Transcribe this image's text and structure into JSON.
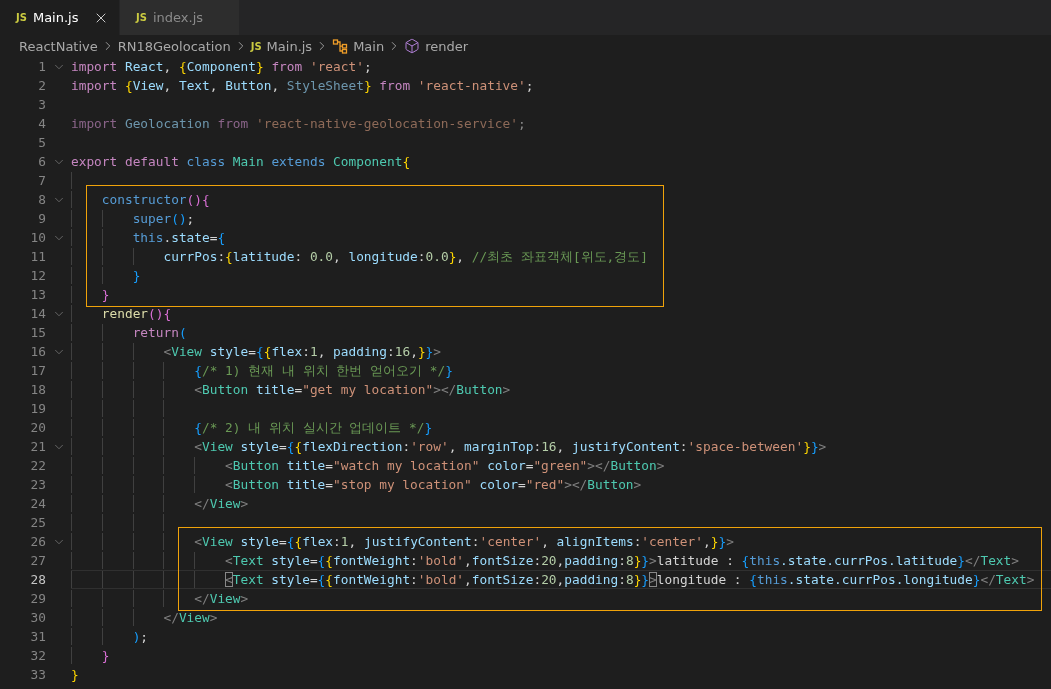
{
  "tabs": [
    {
      "icon_text": "JS",
      "label": "Main.js",
      "selected": true
    },
    {
      "icon_text": "JS",
      "label": "index.js",
      "selected": false
    }
  ],
  "breadcrumbs": [
    {
      "kind": "folder",
      "label": "ReactNative"
    },
    {
      "kind": "folder",
      "label": "RN18Geolocation"
    },
    {
      "kind": "file",
      "icon_text": "JS",
      "label": "Main.js"
    },
    {
      "kind": "class",
      "label": "Main"
    },
    {
      "kind": "method",
      "label": "render"
    }
  ],
  "lines": [
    {
      "number": "1",
      "fold": true,
      "boxed": false,
      "current": false,
      "tokens": [
        {
          "text": "import",
          "kind": "kw"
        },
        {
          "text": " React",
          "kind": "var"
        },
        {
          "text": ", ",
          "kind": "txt"
        },
        {
          "text": "{",
          "kind": "b1"
        },
        {
          "text": "Component",
          "kind": "var"
        },
        {
          "text": "}",
          "kind": "b1"
        },
        {
          "text": " from",
          "kind": "kw"
        },
        {
          "text": " 'react'",
          "kind": "str"
        },
        {
          "text": ";",
          "kind": "txt"
        }
      ]
    },
    {
      "number": "2",
      "fold": false,
      "boxed": false,
      "current": false,
      "tokens": [
        {
          "text": "import",
          "kind": "kw"
        },
        {
          "text": " {",
          "kind": "b1"
        },
        {
          "text": "View",
          "kind": "var"
        },
        {
          "text": ", ",
          "kind": "txt"
        },
        {
          "text": "Text",
          "kind": "var"
        },
        {
          "text": ", ",
          "kind": "txt"
        },
        {
          "text": "Button",
          "kind": "var"
        },
        {
          "text": ", ",
          "kind": "txt"
        },
        {
          "text": "StyleSheet",
          "kind": "dvar"
        },
        {
          "text": "}",
          "kind": "b1"
        },
        {
          "text": " from",
          "kind": "kw"
        },
        {
          "text": " 'react-native'",
          "kind": "str"
        },
        {
          "text": ";",
          "kind": "txt"
        }
      ]
    },
    {
      "number": "3",
      "fold": false,
      "boxed": false,
      "current": false
    },
    {
      "number": "4",
      "fold": false,
      "boxed": false,
      "current": false,
      "tokens": [
        {
          "text": "import",
          "kind": "dkw"
        },
        {
          "text": " Geolocation",
          "kind": "dvar"
        },
        {
          "text": " from",
          "kind": "dkw"
        },
        {
          "text": " 'react-native-geolocation-service'",
          "kind": "dstr"
        },
        {
          "text": ";",
          "kind": "dtxt"
        }
      ]
    },
    {
      "number": "5",
      "fold": false,
      "boxed": false,
      "current": false
    },
    {
      "number": "6",
      "fold": true,
      "boxed": false,
      "current": false,
      "tokens": [
        {
          "text": "export",
          "kind": "kw"
        },
        {
          "text": " default",
          "kind": "kw"
        },
        {
          "text": " class",
          "kind": "blue"
        },
        {
          "text": " Main",
          "kind": "type"
        },
        {
          "text": " extends",
          "kind": "blue"
        },
        {
          "text": " Component",
          "kind": "type"
        },
        {
          "text": "{",
          "kind": "b1"
        }
      ]
    },
    {
      "number": "7",
      "fold": false,
      "boxed": false,
      "current": false
    },
    {
      "number": "8",
      "fold": true,
      "boxed": true,
      "current": false,
      "tokens": [
        {
          "text": "    constructor",
          "kind": "blue"
        },
        {
          "text": "()",
          "kind": "b2"
        },
        {
          "text": "{",
          "kind": "b2"
        }
      ]
    },
    {
      "number": "9",
      "fold": false,
      "boxed": true,
      "current": false,
      "tokens": [
        {
          "text": "        super",
          "kind": "blue"
        },
        {
          "text": "()",
          "kind": "b3"
        },
        {
          "text": ";",
          "kind": "txt"
        }
      ]
    },
    {
      "number": "10",
      "fold": true,
      "boxed": true,
      "current": false,
      "tokens": [
        {
          "text": "        this",
          "kind": "blue"
        },
        {
          "text": ".",
          "kind": "txt"
        },
        {
          "text": "state",
          "kind": "var"
        },
        {
          "text": "=",
          "kind": "txt"
        },
        {
          "text": "{",
          "kind": "b3"
        }
      ]
    },
    {
      "number": "11",
      "fold": false,
      "boxed": true,
      "current": false,
      "tokens": [
        {
          "text": "            currPos",
          "kind": "var"
        },
        {
          "text": ":",
          "kind": "txt"
        },
        {
          "text": "{",
          "kind": "b1"
        },
        {
          "text": "latitude",
          "kind": "var"
        },
        {
          "text": ": ",
          "kind": "txt"
        },
        {
          "text": "0.0",
          "kind": "num"
        },
        {
          "text": ", ",
          "kind": "txt"
        },
        {
          "text": "longitude",
          "kind": "var"
        },
        {
          "text": ":",
          "kind": "txt"
        },
        {
          "text": "0.0",
          "kind": "num"
        },
        {
          "text": "}",
          "kind": "b1"
        },
        {
          "text": ", ",
          "kind": "txt"
        },
        {
          "text": "//최초 좌표객체[위도,경도]",
          "kind": "cmt"
        }
      ]
    },
    {
      "number": "12",
      "fold": false,
      "boxed": true,
      "current": false,
      "tokens": [
        {
          "text": "        }",
          "kind": "b3"
        }
      ]
    },
    {
      "number": "13",
      "fold": false,
      "boxed": true,
      "current": false,
      "tokens": [
        {
          "text": "    }",
          "kind": "b2"
        }
      ]
    },
    {
      "number": "14",
      "fold": true,
      "boxed": false,
      "current": false,
      "tokens": [
        {
          "text": "    render",
          "kind": "fn"
        },
        {
          "text": "()",
          "kind": "b2"
        },
        {
          "text": "{",
          "kind": "b2"
        }
      ]
    },
    {
      "number": "15",
      "fold": false,
      "boxed": false,
      "current": false,
      "tokens": [
        {
          "text": "        return",
          "kind": "kw"
        },
        {
          "text": "(",
          "kind": "b3"
        }
      ]
    },
    {
      "number": "16",
      "fold": true,
      "boxed": false,
      "current": false,
      "tokens": [
        {
          "text": "            <",
          "kind": "tag"
        },
        {
          "text": "View",
          "kind": "type"
        },
        {
          "text": " style",
          "kind": "var"
        },
        {
          "text": "=",
          "kind": "txt"
        },
        {
          "text": "{",
          "kind": "b3"
        },
        {
          "text": "{",
          "kind": "b1"
        },
        {
          "text": "flex",
          "kind": "var"
        },
        {
          "text": ":",
          "kind": "txt"
        },
        {
          "text": "1",
          "kind": "num"
        },
        {
          "text": ", ",
          "kind": "txt"
        },
        {
          "text": "padding",
          "kind": "var"
        },
        {
          "text": ":",
          "kind": "txt"
        },
        {
          "text": "16",
          "kind": "num"
        },
        {
          "text": ",",
          "kind": "txt"
        },
        {
          "text": "}",
          "kind": "b1"
        },
        {
          "text": "}",
          "kind": "b3"
        },
        {
          "text": ">",
          "kind": "tag"
        }
      ]
    },
    {
      "number": "17",
      "fold": false,
      "boxed": false,
      "current": false,
      "tokens": [
        {
          "text": "                {",
          "kind": "b3"
        },
        {
          "text": "/* 1) 현재 내 위치 한번 얻어오기 */",
          "kind": "cmt"
        },
        {
          "text": "}",
          "kind": "b3"
        }
      ]
    },
    {
      "number": "18",
      "fold": false,
      "boxed": false,
      "current": false,
      "tokens": [
        {
          "text": "                <",
          "kind": "tag"
        },
        {
          "text": "Button",
          "kind": "type"
        },
        {
          "text": " title",
          "kind": "var"
        },
        {
          "text": "=",
          "kind": "txt"
        },
        {
          "text": "\"get my location\"",
          "kind": "str"
        },
        {
          "text": "></",
          "kind": "tag"
        },
        {
          "text": "Button",
          "kind": "type"
        },
        {
          "text": ">",
          "kind": "tag"
        }
      ]
    },
    {
      "number": "19",
      "fold": false,
      "boxed": false,
      "current": false
    },
    {
      "number": "20",
      "fold": false,
      "boxed": false,
      "current": false,
      "tokens": [
        {
          "text": "                {",
          "kind": "b3"
        },
        {
          "text": "/* 2) 내 위치 실시간 업데이트 */",
          "kind": "cmt"
        },
        {
          "text": "}",
          "kind": "b3"
        }
      ]
    },
    {
      "number": "21",
      "fold": true,
      "boxed": false,
      "current": false,
      "tokens": [
        {
          "text": "                <",
          "kind": "tag"
        },
        {
          "text": "View",
          "kind": "type"
        },
        {
          "text": " style",
          "kind": "var"
        },
        {
          "text": "=",
          "kind": "txt"
        },
        {
          "text": "{",
          "kind": "b3"
        },
        {
          "text": "{",
          "kind": "b1"
        },
        {
          "text": "flexDirection",
          "kind": "var"
        },
        {
          "text": ":",
          "kind": "txt"
        },
        {
          "text": "'row'",
          "kind": "str"
        },
        {
          "text": ", ",
          "kind": "txt"
        },
        {
          "text": "marginTop",
          "kind": "var"
        },
        {
          "text": ":",
          "kind": "txt"
        },
        {
          "text": "16",
          "kind": "num"
        },
        {
          "text": ", ",
          "kind": "txt"
        },
        {
          "text": "justifyContent",
          "kind": "var"
        },
        {
          "text": ":",
          "kind": "txt"
        },
        {
          "text": "'space-between'",
          "kind": "str"
        },
        {
          "text": "}",
          "kind": "b1"
        },
        {
          "text": "}",
          "kind": "b3"
        },
        {
          "text": ">",
          "kind": "tag"
        }
      ]
    },
    {
      "number": "22",
      "fold": false,
      "boxed": false,
      "current": false,
      "tokens": [
        {
          "text": "                    <",
          "kind": "tag"
        },
        {
          "text": "Button",
          "kind": "type"
        },
        {
          "text": " title",
          "kind": "var"
        },
        {
          "text": "=",
          "kind": "txt"
        },
        {
          "text": "\"watch my location\"",
          "kind": "str"
        },
        {
          "text": " color",
          "kind": "var"
        },
        {
          "text": "=",
          "kind": "txt"
        },
        {
          "text": "\"green\"",
          "kind": "str"
        },
        {
          "text": "></",
          "kind": "tag"
        },
        {
          "text": "Button",
          "kind": "type"
        },
        {
          "text": ">",
          "kind": "tag"
        }
      ]
    },
    {
      "number": "23",
      "fold": false,
      "boxed": false,
      "current": false,
      "tokens": [
        {
          "text": "                    <",
          "kind": "tag"
        },
        {
          "text": "Button",
          "kind": "type"
        },
        {
          "text": " title",
          "kind": "var"
        },
        {
          "text": "=",
          "kind": "txt"
        },
        {
          "text": "\"stop my location\"",
          "kind": "str"
        },
        {
          "text": " color",
          "kind": "var"
        },
        {
          "text": "=",
          "kind": "txt"
        },
        {
          "text": "\"red\"",
          "kind": "str"
        },
        {
          "text": "></",
          "kind": "tag"
        },
        {
          "text": "Button",
          "kind": "type"
        },
        {
          "text": ">",
          "kind": "tag"
        }
      ]
    },
    {
      "number": "24",
      "fold": false,
      "boxed": false,
      "current": false,
      "tokens": [
        {
          "text": "                </",
          "kind": "tag"
        },
        {
          "text": "View",
          "kind": "type"
        },
        {
          "text": ">",
          "kind": "tag"
        }
      ]
    },
    {
      "number": "25",
      "fold": false,
      "boxed": false,
      "current": false
    },
    {
      "number": "26",
      "fold": true,
      "boxed": true,
      "current": false,
      "tokens": [
        {
          "text": "                <",
          "kind": "tag"
        },
        {
          "text": "View",
          "kind": "type"
        },
        {
          "text": " style",
          "kind": "var"
        },
        {
          "text": "=",
          "kind": "txt"
        },
        {
          "text": "{",
          "kind": "b3"
        },
        {
          "text": "{",
          "kind": "b1"
        },
        {
          "text": "flex",
          "kind": "var"
        },
        {
          "text": ":",
          "kind": "txt"
        },
        {
          "text": "1",
          "kind": "num"
        },
        {
          "text": ", ",
          "kind": "txt"
        },
        {
          "text": "justifyContent",
          "kind": "var"
        },
        {
          "text": ":",
          "kind": "txt"
        },
        {
          "text": "'center'",
          "kind": "str"
        },
        {
          "text": ", ",
          "kind": "txt"
        },
        {
          "text": "alignItems",
          "kind": "var"
        },
        {
          "text": ":",
          "kind": "txt"
        },
        {
          "text": "'center'",
          "kind": "str"
        },
        {
          "text": ",",
          "kind": "txt"
        },
        {
          "text": "}",
          "kind": "b1"
        },
        {
          "text": "}",
          "kind": "b3"
        },
        {
          "text": ">",
          "kind": "tag"
        }
      ]
    },
    {
      "number": "27",
      "fold": false,
      "boxed": true,
      "current": false,
      "tokens": [
        {
          "text": "                    <",
          "kind": "tag"
        },
        {
          "text": "Text",
          "kind": "type"
        },
        {
          "text": " style",
          "kind": "var"
        },
        {
          "text": "=",
          "kind": "txt"
        },
        {
          "text": "{",
          "kind": "b3"
        },
        {
          "text": "{",
          "kind": "b1"
        },
        {
          "text": "fontWeight",
          "kind": "var"
        },
        {
          "text": ":",
          "kind": "txt"
        },
        {
          "text": "'bold'",
          "kind": "str"
        },
        {
          "text": ",",
          "kind": "txt"
        },
        {
          "text": "fontSize",
          "kind": "var"
        },
        {
          "text": ":",
          "kind": "txt"
        },
        {
          "text": "20",
          "kind": "num"
        },
        {
          "text": ",",
          "kind": "txt"
        },
        {
          "text": "padding",
          "kind": "var"
        },
        {
          "text": ":",
          "kind": "txt"
        },
        {
          "text": "8",
          "kind": "num"
        },
        {
          "text": "}",
          "kind": "b1"
        },
        {
          "text": "}",
          "kind": "b3"
        },
        {
          "text": ">",
          "kind": "tag"
        },
        {
          "text": "latitude : ",
          "kind": "txt"
        },
        {
          "text": "{",
          "kind": "b3"
        },
        {
          "text": "this",
          "kind": "blue"
        },
        {
          "text": ".state.currPos.latitude",
          "kind": "var"
        },
        {
          "text": "}",
          "kind": "b3"
        },
        {
          "text": "</",
          "kind": "tag"
        },
        {
          "text": "Text",
          "kind": "type"
        },
        {
          "text": ">",
          "kind": "tag"
        }
      ]
    },
    {
      "number": "28",
      "fold": false,
      "boxed": true,
      "current": true,
      "tokens": [
        {
          "text": "                    <",
          "kind": "match"
        },
        {
          "text": "Text",
          "kind": "type"
        },
        {
          "text": " style",
          "kind": "var"
        },
        {
          "text": "=",
          "kind": "txt"
        },
        {
          "text": "{",
          "kind": "b3"
        },
        {
          "text": "{",
          "kind": "b1"
        },
        {
          "text": "fontWeight",
          "kind": "var"
        },
        {
          "text": ":",
          "kind": "txt"
        },
        {
          "text": "'bold'",
          "kind": "str"
        },
        {
          "text": ",",
          "kind": "txt"
        },
        {
          "text": "fontSize",
          "kind": "var"
        },
        {
          "text": ":",
          "kind": "txt"
        },
        {
          "text": "20",
          "kind": "num"
        },
        {
          "text": ",",
          "kind": "txt"
        },
        {
          "text": "padding",
          "kind": "var"
        },
        {
          "text": ":",
          "kind": "txt"
        },
        {
          "text": "8",
          "kind": "num"
        },
        {
          "text": "}",
          "kind": "b1"
        },
        {
          "text": "}",
          "kind": "b3"
        },
        {
          "text": ">",
          "kind": "match"
        },
        {
          "text": "longitude : ",
          "kind": "txt"
        },
        {
          "text": "{",
          "kind": "b3"
        },
        {
          "text": "this",
          "kind": "blue"
        },
        {
          "text": ".state.currPos.longitude",
          "kind": "var"
        },
        {
          "text": "}",
          "kind": "b3"
        },
        {
          "text": "</",
          "kind": "tag"
        },
        {
          "text": "Text",
          "kind": "type"
        },
        {
          "text": ">",
          "kind": "tag"
        }
      ]
    },
    {
      "number": "29",
      "fold": false,
      "boxed": true,
      "current": false,
      "tokens": [
        {
          "text": "                </",
          "kind": "tag"
        },
        {
          "text": "View",
          "kind": "type"
        },
        {
          "text": ">",
          "kind": "tag"
        }
      ]
    },
    {
      "number": "30",
      "fold": false,
      "boxed": false,
      "current": false,
      "tokens": [
        {
          "text": "            </",
          "kind": "tag"
        },
        {
          "text": "View",
          "kind": "type"
        },
        {
          "text": ">",
          "kind": "tag"
        }
      ]
    },
    {
      "number": "31",
      "fold": false,
      "boxed": false,
      "current": false,
      "tokens": [
        {
          "text": "        )",
          "kind": "b3"
        },
        {
          "text": ";",
          "kind": "txt"
        }
      ]
    },
    {
      "number": "32",
      "fold": false,
      "boxed": false,
      "current": false,
      "tokens": [
        {
          "text": "    }",
          "kind": "b2"
        }
      ]
    },
    {
      "number": "33",
      "fold": false,
      "boxed": false,
      "current": false,
      "tokens": [
        {
          "text": "}",
          "kind": "b1"
        }
      ]
    }
  ]
}
